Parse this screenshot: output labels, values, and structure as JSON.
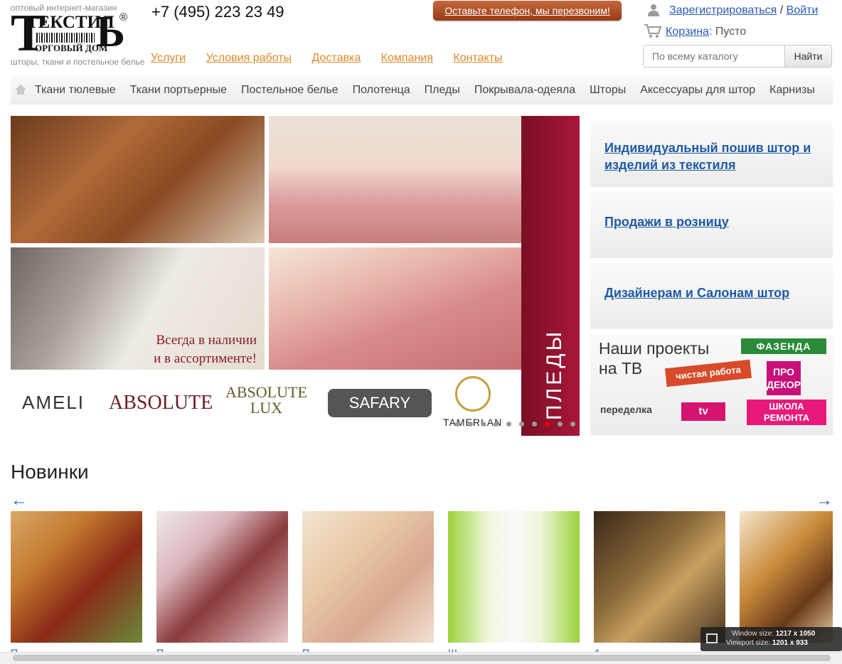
{
  "header": {
    "tagline": "оптовый интернет-магазин",
    "logo_word": "ТЕКСТИЛ",
    "logo_big": "Ь",
    "logo_t": "Т",
    "logo_sub": "ОРГОВЫЙ ДОМ",
    "logo_reg": "®",
    "logo_desc": "шторы, ткани и постельное белье",
    "phone": "+7 (495) 223 23 49",
    "callback": "Оставьте телефон, мы перезвоним!",
    "register": "Зарегистрироваться",
    "separator": " / ",
    "login": "Войти",
    "cart_label": "Корзина",
    "cart_status": ": Пусто",
    "search_placeholder": "По всему каталогу",
    "search_button": "Найти"
  },
  "topnav": [
    "Услуги",
    "Условия работы",
    "Доставка",
    "Компания",
    "Контакты"
  ],
  "catnav": [
    "Ткани тюлевые",
    "Ткани портьерные",
    "Постельное белье",
    "Полотенца",
    "Пледы",
    "Покрывала-одеяла",
    "Шторы",
    "Аксессуары для штор",
    "Карнизы"
  ],
  "banner": {
    "side_text": "ПЛЕДЫ",
    "slogan_1": "Всегда в наличии",
    "slogan_2": "и в ассортименте!",
    "brands": {
      "ameli": "AMELI",
      "absolute": "ABSOLUTE",
      "abs_lux_1": "ABSOLUTE",
      "abs_lux_2": "LUX",
      "safary": "SAFARY",
      "tamerlan": "TAMERLAN"
    },
    "dots_total": 10,
    "dots_active_index": 7
  },
  "promos": {
    "p1": "Индивидуальный пошив штор и изделий из текстиля",
    "p2": "Продажи в розницу",
    "p3": "Дизайнерам и Салонам штор"
  },
  "tv": {
    "title_1": "Наши проекты",
    "title_2": "на ТВ",
    "fazenda": "ФАЗЕНДА",
    "chistaya": "чистая работа",
    "pro_1": "ПРО",
    "pro_2": "ДЕКОР",
    "peredelka": "переделка",
    "tvlogo": "tv",
    "shkola_1": "ШКОЛА",
    "shkola_2": "РЕМОНТА"
  },
  "new_section": {
    "title": "Новинки",
    "prev": "←",
    "next": "→",
    "cards": [
      {
        "label": "П"
      },
      {
        "label": "П"
      },
      {
        "label": "П"
      },
      {
        "label": "Ш"
      },
      {
        "label": "А"
      },
      {
        "label": ""
      }
    ]
  },
  "overlay": {
    "window_label": "Window size:",
    "window_value": "1217 x 1050",
    "viewport_label": "Viewport size:",
    "viewport_value": "1201 x 933"
  }
}
